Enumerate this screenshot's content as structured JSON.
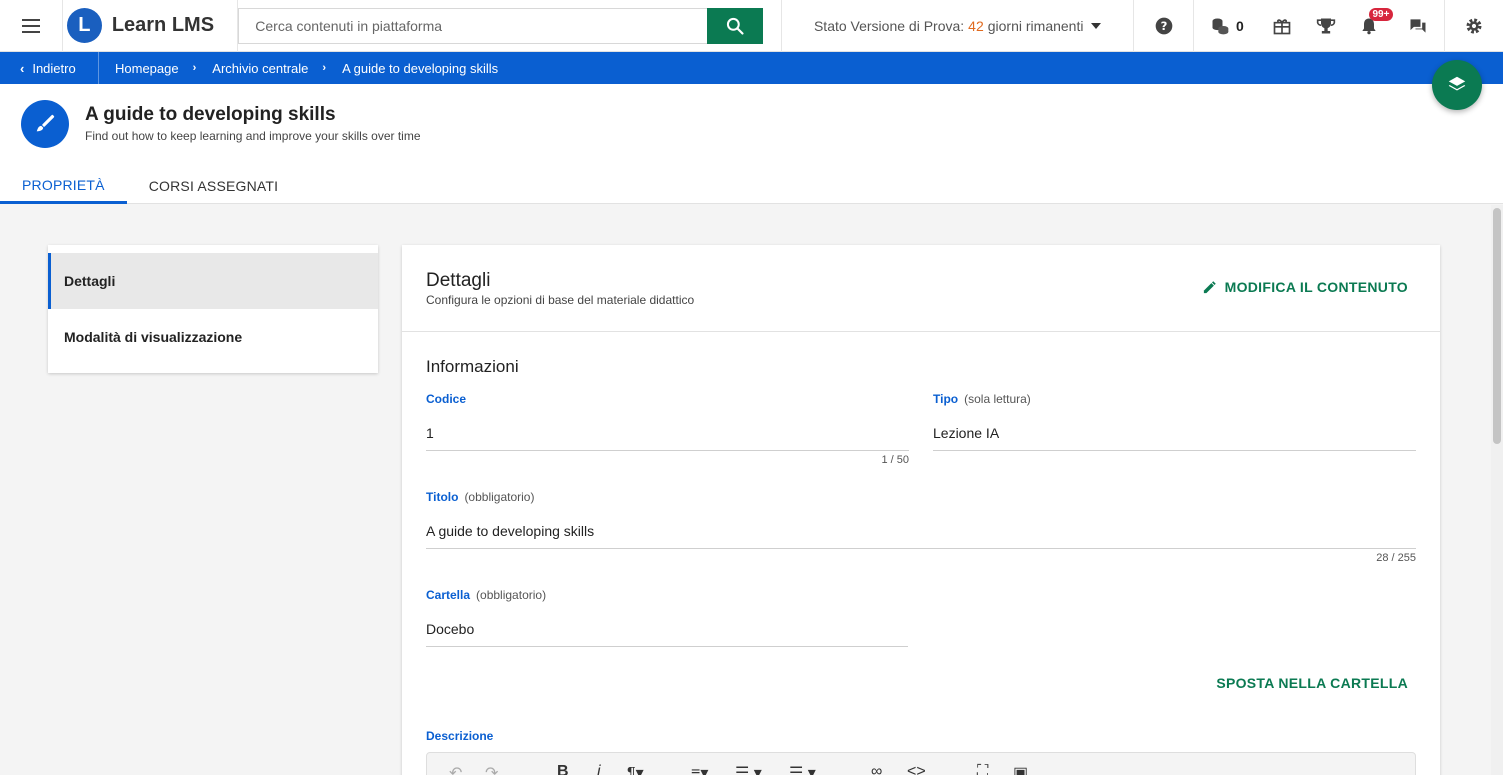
{
  "header": {
    "logo_mark": "L",
    "logo_text": "Learn LMS",
    "search_placeholder": "Cerca contenuti in piattaforma",
    "trial_prefix": "Stato Versione di Prova:",
    "trial_days": "42",
    "trial_suffix": "giorni rimanenti",
    "coins_count": "0",
    "notifications_badge": "99+"
  },
  "breadcrumb": {
    "back_label": "Indietro",
    "items": [
      "Homepage",
      "Archivio centrale",
      "A guide to developing skills"
    ]
  },
  "page": {
    "title": "A guide to developing skills",
    "subtitle": "Find out how to keep learning and improve your skills over time"
  },
  "tabs": [
    {
      "label": "PROPRIETÀ",
      "active": true
    },
    {
      "label": "CORSI ASSEGNATI",
      "active": false
    }
  ],
  "sidemenu": {
    "items": [
      {
        "label": "Dettagli",
        "active": true
      },
      {
        "label": "Modalità di visualizzazione",
        "active": false
      }
    ]
  },
  "panel": {
    "title": "Dettagli",
    "subtitle": "Configura le opzioni di base del materiale didattico",
    "edit_label": "MODIFICA IL CONTENUTO",
    "section_title": "Informazioni",
    "fields": {
      "code": {
        "label": "Codice",
        "value": "1",
        "counter": "1 / 50"
      },
      "type": {
        "label": "Tipo",
        "note": "(sola lettura)",
        "value": "Lezione IA"
      },
      "title": {
        "label": "Titolo",
        "note": "(obbligatorio)",
        "value": "A guide to developing skills",
        "counter": "28 / 255"
      },
      "folder": {
        "label": "Cartella",
        "note": "(obbligatorio)",
        "value": "Docebo"
      }
    },
    "move_label": "SPOSTA NELLA CARTELLA",
    "description_label": "Descrizione"
  },
  "colors": {
    "primary_blue": "#0a5fd1",
    "action_green": "#0b7a52",
    "trial_orange": "#e06a1f",
    "badge_red": "#d7263d"
  },
  "icons": [
    "menu-icon",
    "search-icon",
    "help-icon",
    "coins-icon",
    "gift-icon",
    "trophy-icon",
    "bell-icon",
    "chat-icon",
    "gear-icon",
    "brush-icon",
    "layers-icon",
    "pencil-icon"
  ]
}
